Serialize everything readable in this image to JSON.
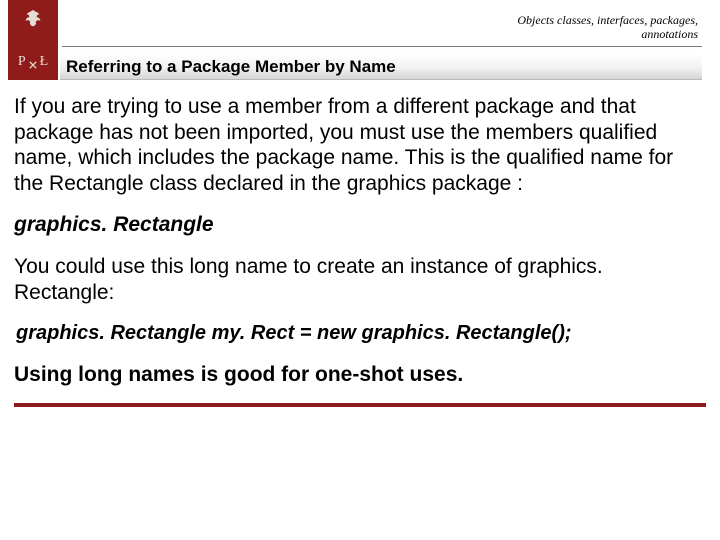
{
  "header": {
    "topic": "Objects classes, interfaces, packages, annotations",
    "logo_left": "P",
    "logo_right": "Ł",
    "title": "Referring to a Package Member by Name"
  },
  "body": {
    "intro": "If you are trying to use a member from a different package and that package has not been imported, you must use the members qualified name, which includes the package name. This is the qualified name for the Rectangle class declared in the graphics package :",
    "qualified_name": "graphics. Rectangle",
    "usage_lead": "You could use this long name to create an instance of graphics. Rectangle:",
    "code_line": "graphics. Rectangle my. Rect = new graphics. Rectangle();",
    "closing": "Using long names is good for one-shot uses."
  },
  "colors": {
    "brand_red": "#8f1b1b"
  }
}
